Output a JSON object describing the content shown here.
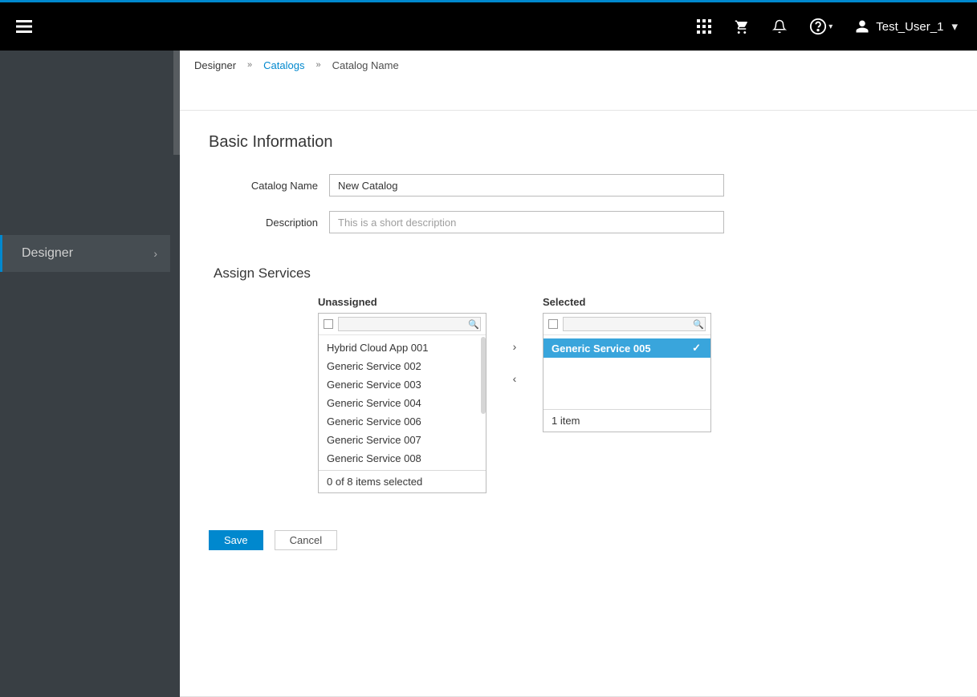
{
  "header": {
    "user_name": "Test_User_1"
  },
  "sidebar": {
    "active_item_label": "Designer"
  },
  "breadcrumb": {
    "root": "Designer",
    "link": "Catalogs",
    "current": "Catalog Name"
  },
  "basic_info": {
    "heading": "Basic Information",
    "name_label": "Catalog Name",
    "name_value": "New Catalog",
    "description_label": "Description",
    "description_placeholder": "This is a short description"
  },
  "assign": {
    "heading": "Assign Services",
    "unassigned_label": "Unassigned",
    "selected_label": "Selected",
    "unassigned_items": [
      "Hybrid Cloud App 001",
      "Generic Service 002",
      "Generic Service 003",
      "Generic Service 004",
      "Generic Service 006",
      "Generic Service 007",
      "Generic Service 008"
    ],
    "unassigned_footer": "0 of 8 items selected",
    "selected_items": [
      "Generic Service 005"
    ],
    "selected_footer": "1 item"
  },
  "actions": {
    "save": "Save",
    "cancel": "Cancel"
  }
}
